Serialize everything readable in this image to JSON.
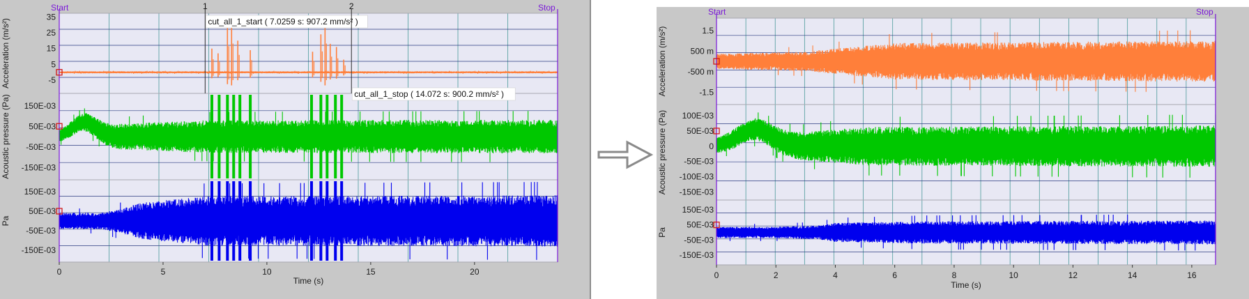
{
  "arrow_icon": "right-arrow-icon",
  "colors": {
    "frame": "#c8c8c8",
    "plot_background": "#e8e8f4",
    "grid_horizontal": "#2a3a80",
    "grid_vertical": "#4a9a9a",
    "cursor": "#7a18d8",
    "selection_marker": "#d01818",
    "acceleration": "#ff7f3a",
    "acoustic_pressure": "#00c800",
    "pa_channel": "#0000ee"
  },
  "chart_data": [
    {
      "type": "line",
      "panel": "before",
      "cursor_start_label": "Start",
      "cursor_stop_label": "Stop",
      "x": {
        "label": "Time (s)",
        "range": [
          0,
          24
        ],
        "ticks": [
          "0",
          "5",
          "10",
          "15",
          "20"
        ],
        "tick_values": [
          0,
          5,
          10,
          15,
          20
        ]
      },
      "markers": [
        {
          "label": "1",
          "x": 7.0259,
          "annotation": "cut_all_1_start ( 7.0259 s:  907.2 mm/s² )"
        },
        {
          "label": "2",
          "x": 14.072,
          "annotation": "cut_all_1_stop ( 14.072 s:  900.2 mm/s² )"
        }
      ],
      "channels": [
        {
          "name": "acceleration",
          "ylabel": "Acceleration (m/s²)",
          "yticks": [
            "35",
            "25",
            "15",
            "5",
            "-5"
          ],
          "ytick_values": [
            35,
            25,
            15,
            5,
            -5
          ],
          "ylim": [
            -12,
            36
          ],
          "signal": {
            "envelope_x": [
              0,
              24
            ],
            "envelope_amplitude": [
              0.6,
              0.6
            ],
            "baseline": 0,
            "bursts": [
              {
                "x": 7.35,
                "peak": 15
              },
              {
                "x": 7.65,
                "peak": 12
              },
              {
                "x": 8.1,
                "peak": 30
              },
              {
                "x": 8.3,
                "peak": 33
              },
              {
                "x": 8.6,
                "peak": 20
              },
              {
                "x": 9.2,
                "peak": 14
              },
              {
                "x": 12.2,
                "peak": 13
              },
              {
                "x": 12.6,
                "peak": 24
              },
              {
                "x": 12.8,
                "peak": 33
              },
              {
                "x": 13.05,
                "peak": 18
              },
              {
                "x": 13.35,
                "peak": 16
              },
              {
                "x": 13.7,
                "peak": 8
              }
            ]
          }
        },
        {
          "name": "acoustic_pressure",
          "ylabel": "Acoustic pressure (Pa)",
          "yticks": [
            "150E-03",
            "50E-03",
            "-50E-03",
            "-150E-03"
          ],
          "ytick_values": [
            0.15,
            0.05,
            -0.05,
            -0.15
          ],
          "ylim": [
            -0.2,
            0.2
          ],
          "signal": {
            "envelope_x": [
              0,
              0.5,
              3,
              7,
              24
            ],
            "envelope_amplitude": [
              0.03,
              0.035,
              0.06,
              0.075,
              0.078
            ],
            "baseline": 0,
            "hump": {
              "x": 1.2,
              "height": 0.07,
              "width": 0.8
            },
            "spikes_x": [
              7.35,
              7.7,
              8.1,
              8.4,
              8.7,
              9.2,
              12.15,
              12.6,
              12.9,
              13.3,
              13.6
            ]
          }
        },
        {
          "name": "pa_channel",
          "ylabel": "Pa",
          "yticks": [
            "150E-03",
            "50E-03",
            "-50E-03",
            "-150E-03"
          ],
          "ytick_values": [
            0.15,
            0.05,
            -0.05,
            -0.15
          ],
          "ylim": [
            -0.2,
            0.2
          ],
          "signal": {
            "envelope_x": [
              0,
              2,
              3,
              4,
              7,
              24
            ],
            "envelope_amplitude": [
              0.04,
              0.04,
              0.06,
              0.09,
              0.12,
              0.125
            ],
            "baseline": 0,
            "spikes_x": [
              7.35,
              7.7,
              8.1,
              8.4,
              8.7,
              9.2,
              12.15,
              12.6,
              12.9,
              13.3,
              13.6
            ]
          }
        }
      ]
    },
    {
      "type": "line",
      "panel": "after",
      "cursor_start_label": "Start",
      "cursor_stop_label": "Stop",
      "x": {
        "label": "Time (s)",
        "range": [
          0,
          16.8
        ],
        "ticks": [
          "0",
          "2",
          "4",
          "6",
          "8",
          "10",
          "12",
          "14",
          "16"
        ],
        "tick_values": [
          0,
          2,
          4,
          6,
          8,
          10,
          12,
          14,
          16
        ]
      },
      "markers": [],
      "channels": [
        {
          "name": "acceleration",
          "ylabel": "Acceleration (m/s²)",
          "yticks": [
            "1.5",
            "500 m",
            "-500 m",
            "-1.5"
          ],
          "ytick_values": [
            1.5,
            0.5,
            -0.5,
            -1.5
          ],
          "ylim": [
            -2,
            2
          ],
          "signal": {
            "envelope_x": [
              0,
              3,
              6,
              16.8
            ],
            "envelope_amplitude": [
              0.35,
              0.45,
              0.85,
              0.95
            ],
            "baseline": 0
          }
        },
        {
          "name": "acoustic_pressure",
          "ylabel": "Acoustic pressure (Pa)",
          "yticks": [
            "100E-03",
            "50E-03",
            "0",
            "-50E-03",
            "-100E-03",
            "-150E-03"
          ],
          "ytick_values": [
            0.1,
            0.05,
            0,
            -0.05,
            -0.1,
            -0.15
          ],
          "ylim": [
            -0.17,
            0.13
          ],
          "signal": {
            "envelope_x": [
              0,
              0.5,
              3,
              5,
              16.8
            ],
            "envelope_amplitude": [
              0.025,
              0.03,
              0.045,
              0.06,
              0.065
            ],
            "baseline": 0,
            "hump": {
              "x": 1.3,
              "height": 0.055,
              "width": 0.8
            }
          }
        },
        {
          "name": "pa_channel",
          "ylabel": "Pa",
          "yticks": [
            "150E-03",
            "50E-03",
            "-50E-03",
            "-150E-03"
          ],
          "ytick_values": [
            0.15,
            0.05,
            -0.05,
            -0.15
          ],
          "ylim": [
            -0.2,
            0.2
          ],
          "signal": {
            "envelope_x": [
              0,
              2,
              3.5,
              4,
              7,
              16.8
            ],
            "envelope_amplitude": [
              0.035,
              0.035,
              0.045,
              0.06,
              0.07,
              0.075
            ],
            "baseline": 0
          }
        }
      ]
    }
  ]
}
